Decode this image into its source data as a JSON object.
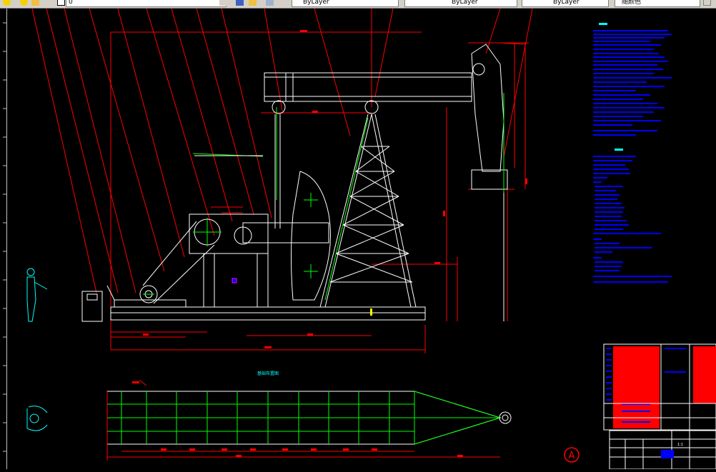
{
  "toolbar": {
    "layer_value": "0",
    "color_value": "ByLayer",
    "linetype_value": "ByLayer",
    "lineweight_value": "ByLayer",
    "plotstyle_value": "随颜色"
  },
  "colors": {
    "background": "#000000",
    "outline": "#ffffff",
    "dimension": "#ff0000",
    "centerline": "#00ff00",
    "notes": "#0000ff",
    "titleblock_fill": "#ff0000",
    "figure": "#00ffff",
    "toolbar_bg": "#d4d0c8"
  },
  "drawing": {
    "section_title": "基础布置图",
    "revision_mark": "A",
    "cell_label": "1:1"
  }
}
